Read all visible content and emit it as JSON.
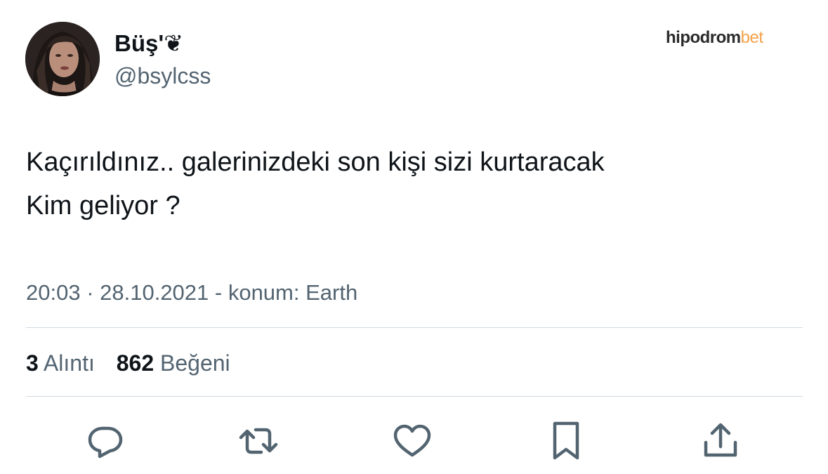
{
  "tweet": {
    "display_name": "Büş'❦",
    "handle": "@bsylcss",
    "text_lines": [
      "Kaçırıldınız.. galerinizdeki son kişi sizi kurtaracak",
      "Kim geliyor ?"
    ],
    "time": "20:03",
    "date": "28.10.2021",
    "location_text": "konum: Earth",
    "meta_line": "20:03 · 28.10.2021 - konum: Earth"
  },
  "stats": {
    "quotes_count": "3",
    "quotes_label": "Alıntı",
    "likes_count": "862",
    "likes_label": "Beğeni"
  },
  "watermark": {
    "main": "hipodrom",
    "accent": "bet"
  },
  "actions": [
    {
      "icon": "reply-icon"
    },
    {
      "icon": "retweet-icon"
    },
    {
      "icon": "like-icon"
    },
    {
      "icon": "bookmark-icon"
    },
    {
      "icon": "share-icon"
    }
  ],
  "colors": {
    "text_primary": "#0f1419",
    "text_secondary": "#536471",
    "divider": "#cfd9de",
    "watermark_accent": "#f3a24a"
  }
}
